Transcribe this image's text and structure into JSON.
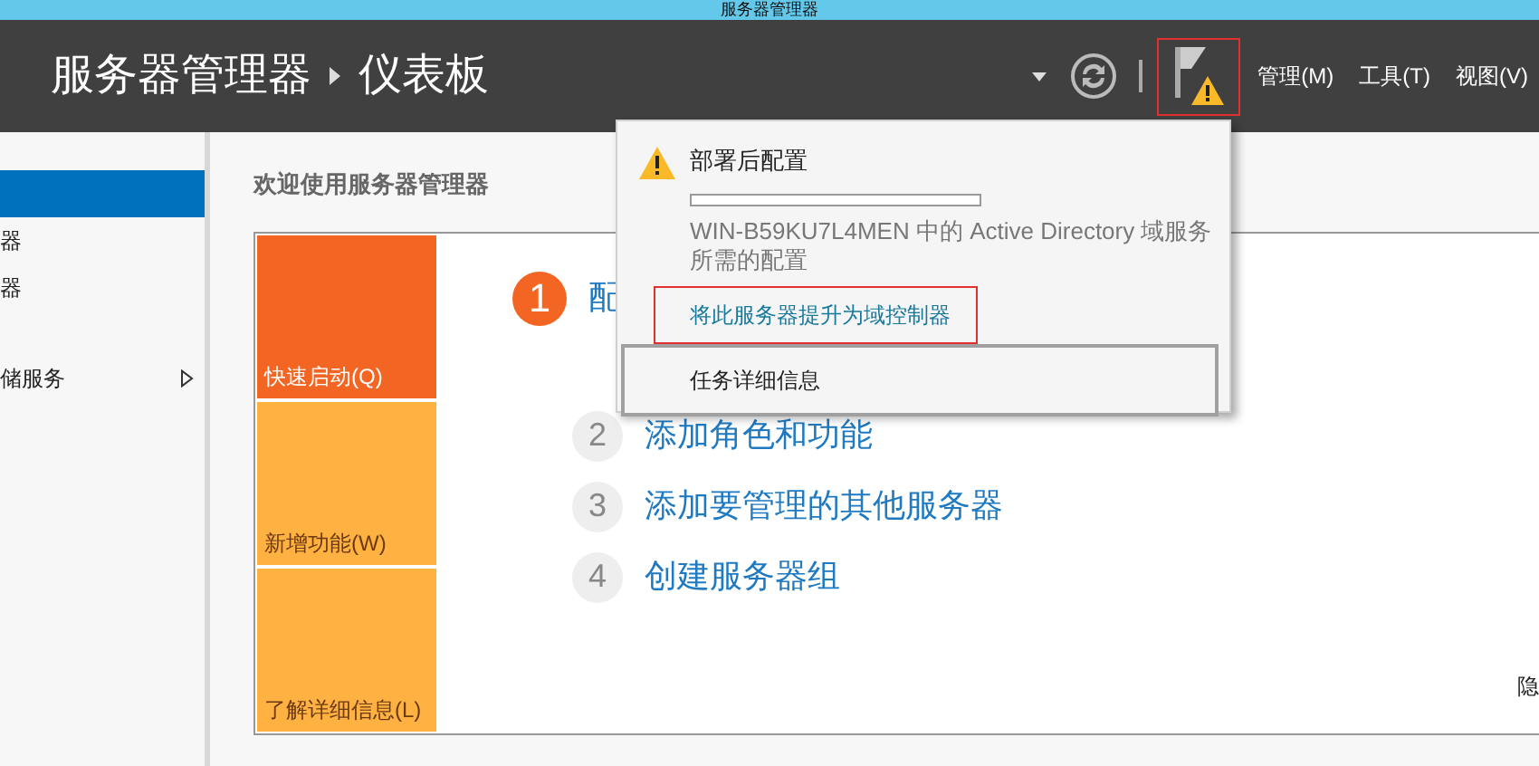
{
  "title_bar": {
    "title": "服务器管理器"
  },
  "header": {
    "breadcrumb": [
      "服务器管理器",
      "仪表板"
    ],
    "notifications_highlighted": true,
    "menu": [
      {
        "label": "管理(M)"
      },
      {
        "label": "工具(T)"
      },
      {
        "label": "视图(V)"
      }
    ]
  },
  "sidebar": {
    "items": [
      {
        "selected": true,
        "expandable": false
      },
      {
        "label": "器",
        "selected": false,
        "expandable": false
      },
      {
        "label": "器",
        "selected": false,
        "expandable": false
      },
      {
        "label": "储服务",
        "selected": false,
        "expandable": true
      }
    ]
  },
  "main": {
    "welcome_title": "欢迎使用服务器管理器",
    "tiles": [
      {
        "label": "快速启动(Q)",
        "selected": true
      },
      {
        "label": "新增功能(W)",
        "selected": false
      },
      {
        "label": "了解详细信息(L)",
        "selected": false
      }
    ],
    "steps": [
      {
        "number": "1",
        "label": "配",
        "active": true
      },
      {
        "number": "2",
        "label": "添加角色和功能",
        "active": false
      },
      {
        "number": "3",
        "label": "添加要管理的其他服务器",
        "active": false
      },
      {
        "number": "4",
        "label": "创建服务器组",
        "active": false
      }
    ],
    "edge_text": "隐"
  },
  "notification_popup": {
    "title": "部署后配置",
    "level": 0,
    "description": "WIN-B59KU7L4MEN 中的 Active Directory 域服务所需的配置",
    "link": "将此服务器提升为域控制器",
    "link_highlighted": true,
    "button": "任务详细信息"
  }
}
